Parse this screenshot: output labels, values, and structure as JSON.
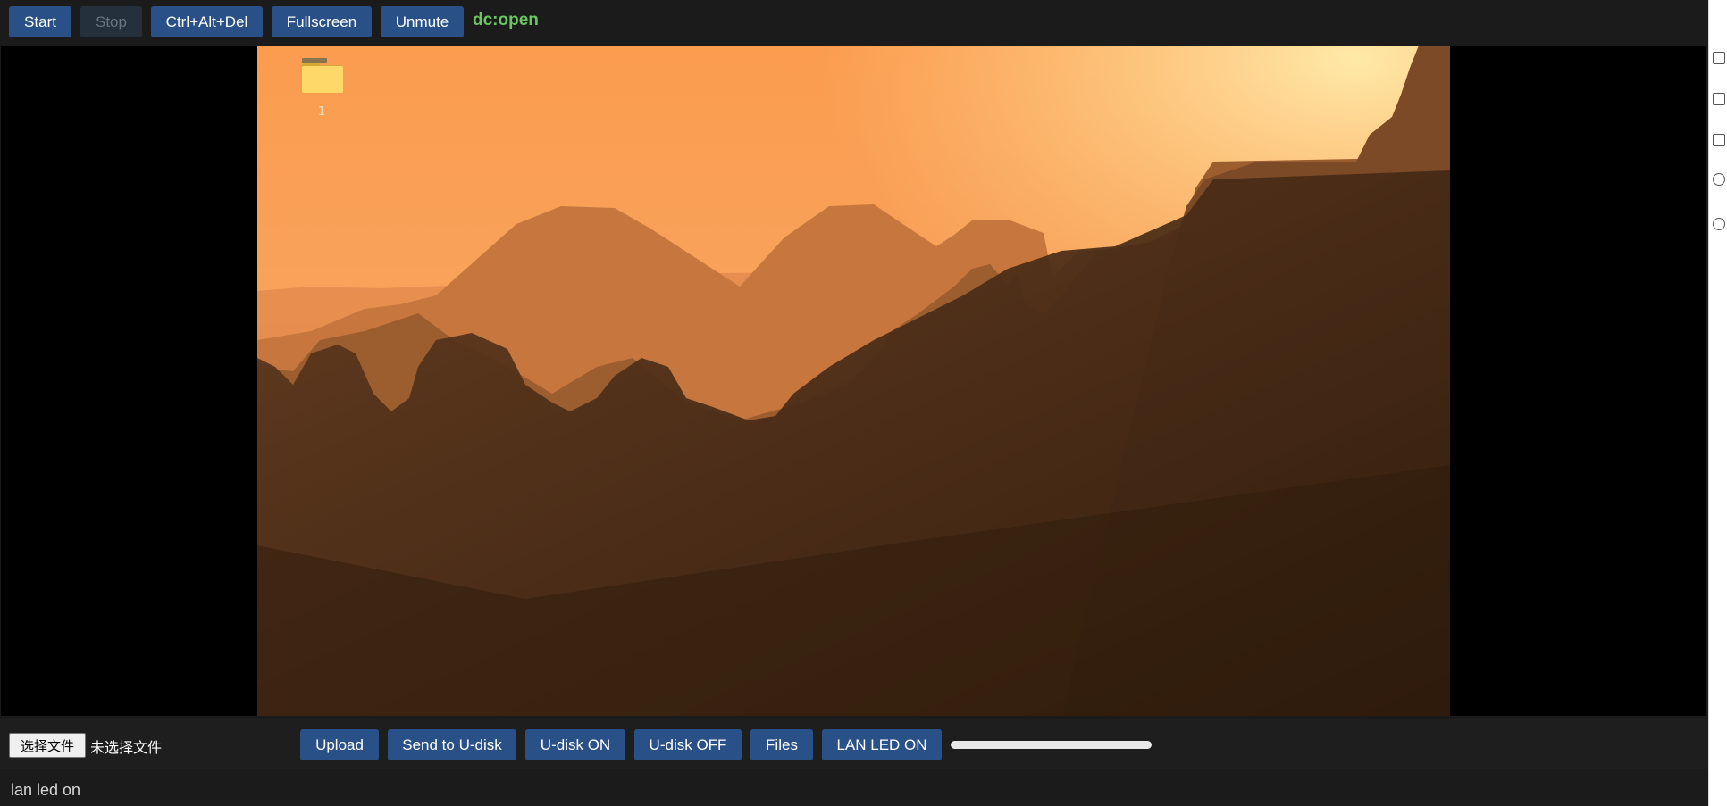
{
  "toolbar": {
    "start_label": "Start",
    "stop_label": "Stop",
    "cad_label": "Ctrl+Alt+Del",
    "fullscreen_label": "Fullscreen",
    "unmute_label": "Unmute",
    "status_text": "dc:open"
  },
  "desktop": {
    "folder_label": "1"
  },
  "bottom": {
    "choose_file_label": "选择文件",
    "no_file_text": "未选择文件",
    "upload_label": "Upload",
    "send_udisk_label": "Send to U-disk",
    "udisk_on_label": "U-disk ON",
    "udisk_off_label": "U-disk OFF",
    "files_label": "Files",
    "lan_led_label": "LAN LED ON"
  },
  "log": {
    "message": "lan led on"
  },
  "colors": {
    "button_bg": "#2a5187",
    "status_ok": "#6cc563",
    "background": "#1b1b1b"
  }
}
